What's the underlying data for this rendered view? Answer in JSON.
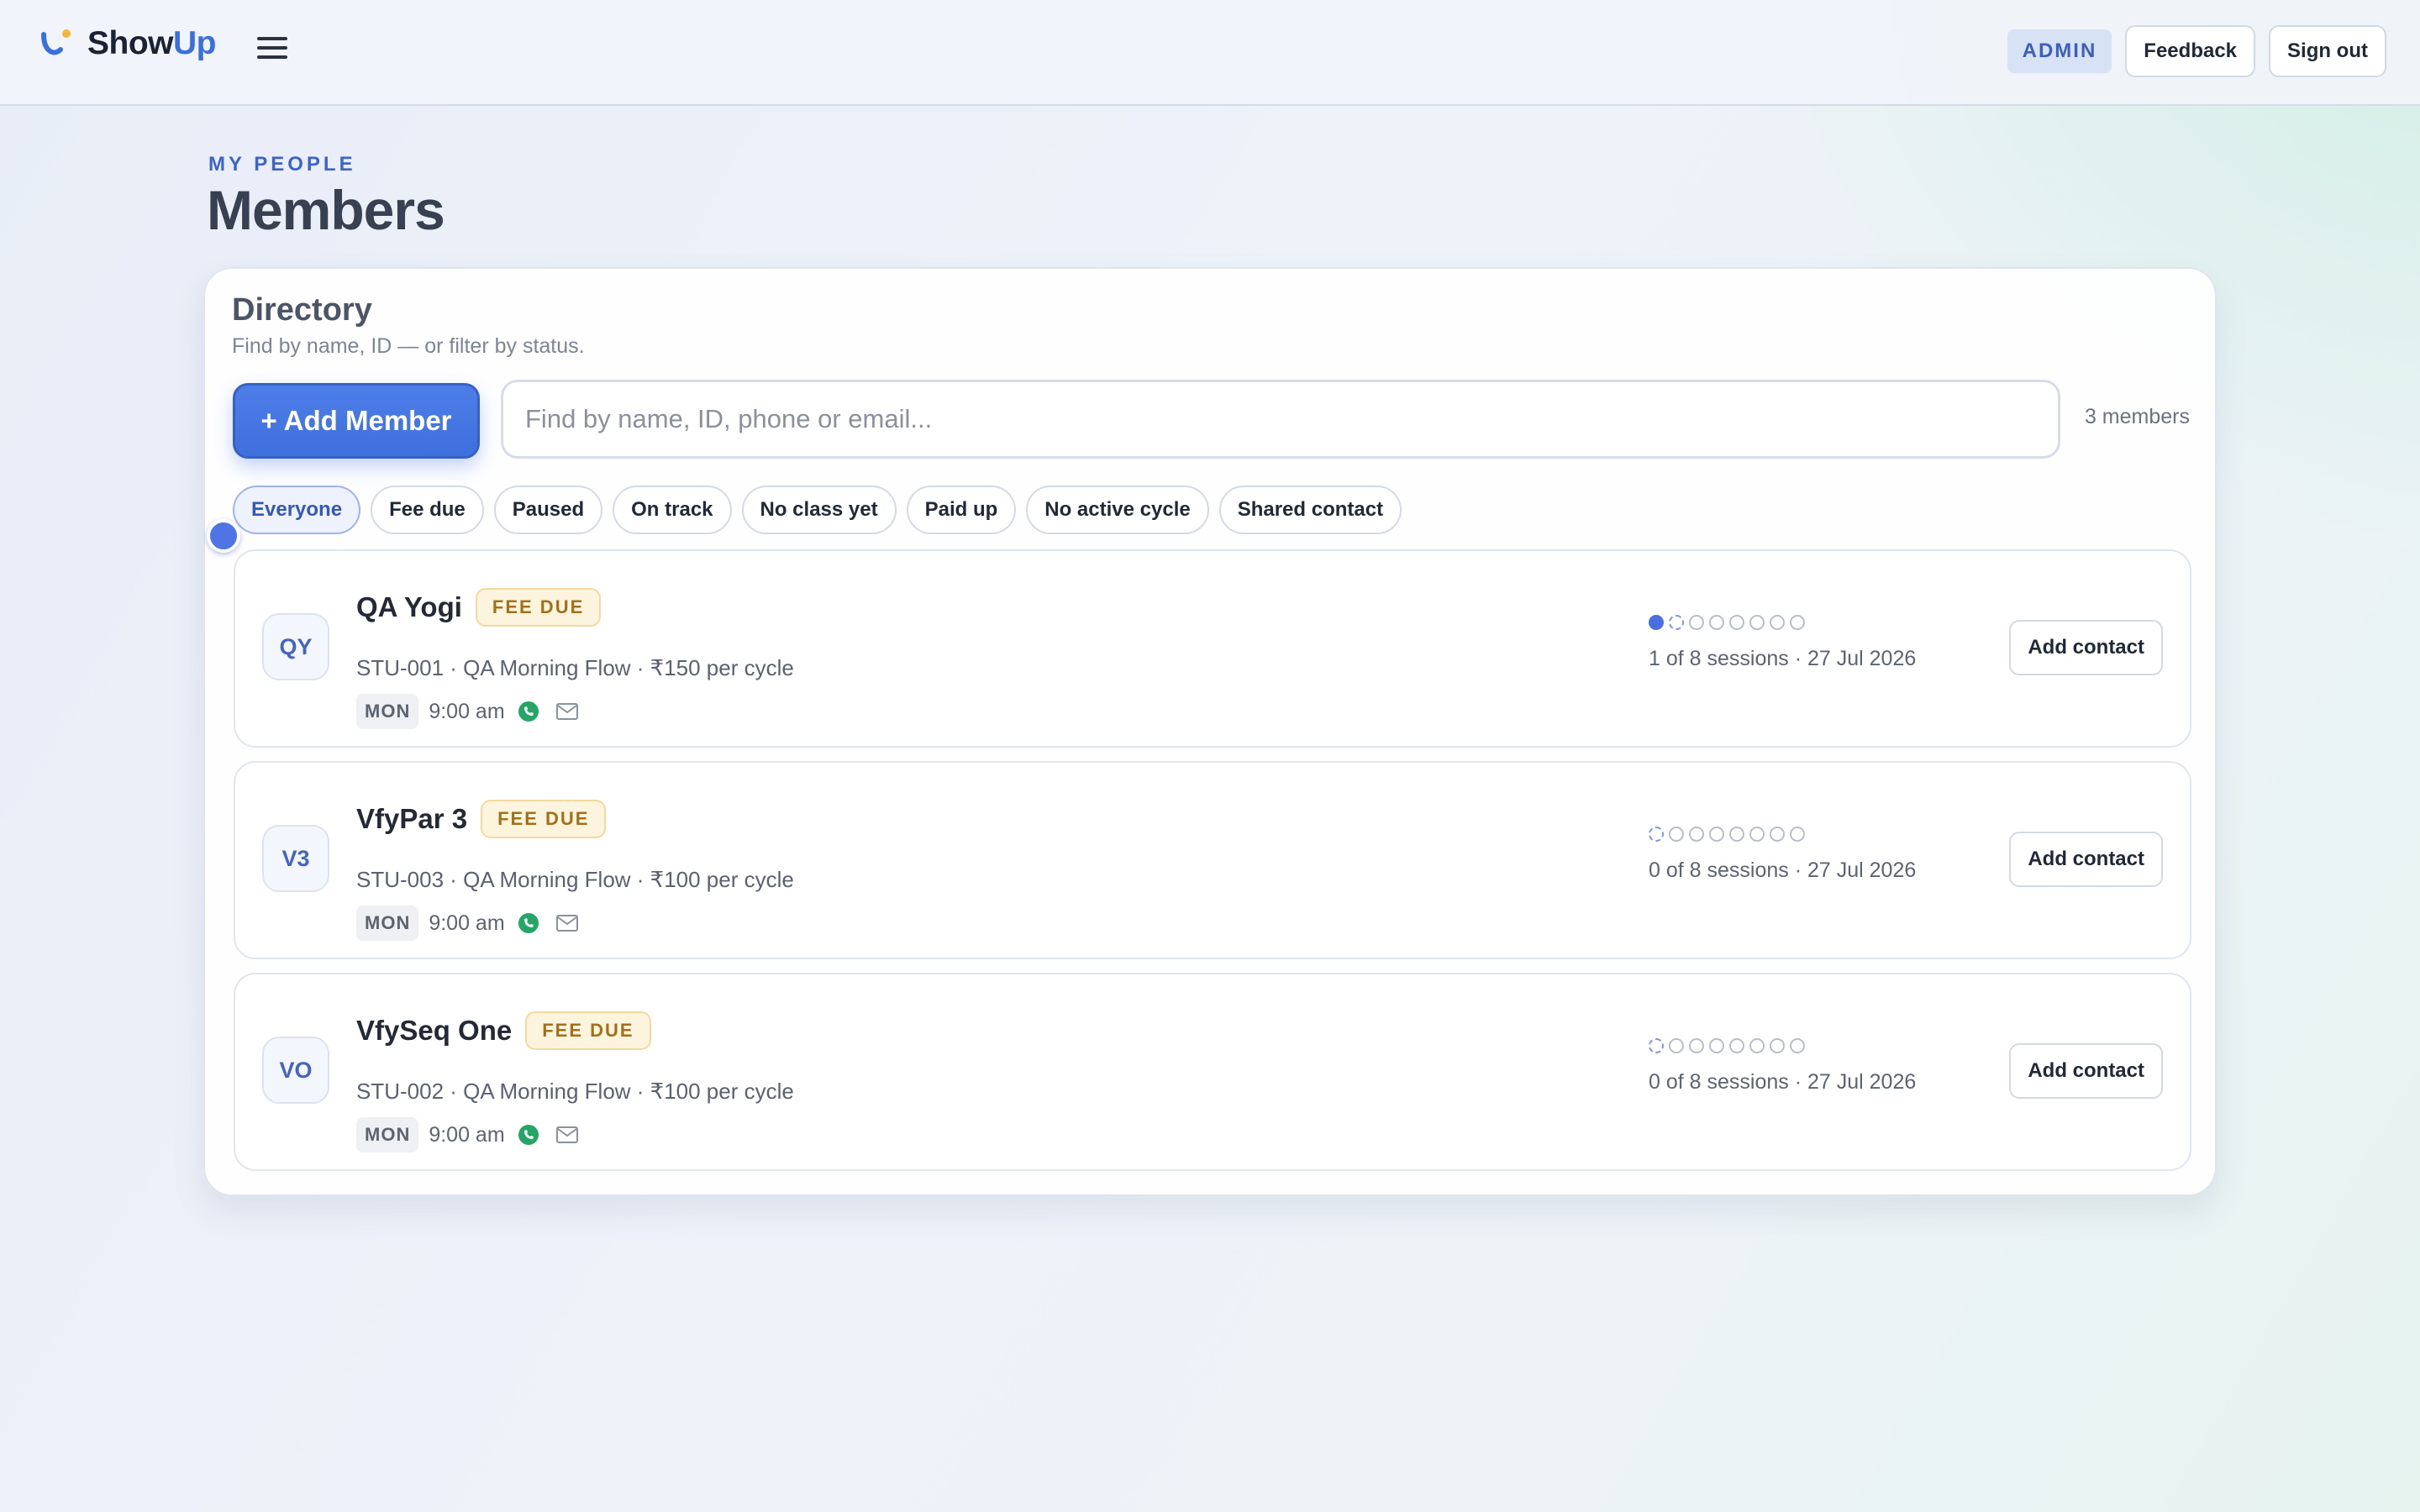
{
  "header": {
    "brand_prefix": "Show",
    "brand_suffix": "Up",
    "role_badge": "ADMIN",
    "feedback_label": "Feedback",
    "signout_label": "Sign out"
  },
  "page": {
    "eyebrow": "MY PEOPLE",
    "title": "Members"
  },
  "directory": {
    "title": "Directory",
    "subtitle": "Find by name, ID — or filter by status.",
    "add_label": "+ Add Member",
    "search_placeholder": "Find by name, ID, phone or email...",
    "search_value": "",
    "count_text": "3 members",
    "filters": [
      "Everyone",
      "Fee due",
      "Paused",
      "On track",
      "No class yet",
      "Paid up",
      "No active cycle",
      "Shared contact"
    ],
    "active_filter": "Everyone"
  },
  "members": [
    {
      "initials": "QY",
      "name": "QA Yogi",
      "badge": "FEE DUE",
      "meta": "STU-001 · QA Morning Flow · ₹150 per cycle",
      "day": "MON",
      "time": "9:00 am",
      "sessions_done": 1,
      "sessions_total": 8,
      "sessions_text": "1 of 8 sessions · 27 Jul 2026",
      "action_label": "Add contact"
    },
    {
      "initials": "V3",
      "name": "VfyPar 3",
      "badge": "FEE DUE",
      "meta": "STU-003 · QA Morning Flow · ₹100 per cycle",
      "day": "MON",
      "time": "9:00 am",
      "sessions_done": 0,
      "sessions_total": 8,
      "sessions_text": "0 of 8 sessions · 27 Jul 2026",
      "action_label": "Add contact"
    },
    {
      "initials": "VO",
      "name": "VfySeq One",
      "badge": "FEE DUE",
      "meta": "STU-002 · QA Morning Flow · ₹100 per cycle",
      "day": "MON",
      "time": "9:00 am",
      "sessions_done": 0,
      "sessions_total": 8,
      "sessions_text": "0 of 8 sessions · 27 Jul 2026",
      "action_label": "Add contact"
    }
  ],
  "colors": {
    "accent": "#3f6fdc",
    "fee_due_bg": "#fdf4de",
    "fee_due_text": "#a3701a",
    "whatsapp": "#25a566"
  }
}
